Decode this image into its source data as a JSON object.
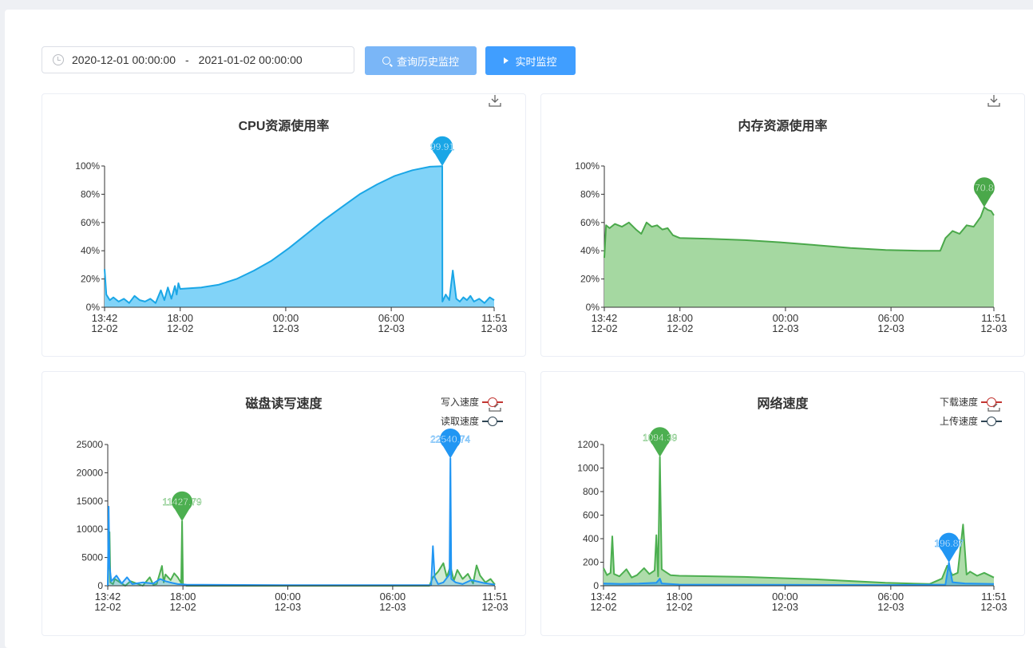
{
  "toolbar": {
    "range_start": "2020-12-01 00:00:00",
    "range_separator": "-",
    "range_end": "2021-01-02 00:00:00",
    "history_button": "查询历史监控",
    "live_button": "实时监控"
  },
  "icons": {
    "clock": "clock-icon",
    "search": "search-icon",
    "play": "play-icon",
    "download": "download-icon"
  },
  "colors": {
    "primary": "#409eff",
    "primary_light": "#7ab6f7",
    "cpu_line": "#1aa6e6",
    "cpu_fill": "#81d3f8",
    "mem_line": "#4aa84a",
    "mem_fill": "#a5d8a1",
    "write_series": "#4caf50",
    "read_series": "#2196f3",
    "legend_write": "#c23531",
    "legend_read": "#2f4554"
  },
  "chart_data": [
    {
      "id": "cpu",
      "type": "area",
      "title": "CPU资源使用率",
      "x_ticks": [
        [
          "13:42",
          "12-02"
        ],
        [
          "18:00",
          "12-02"
        ],
        [
          "00:00",
          "12-03"
        ],
        [
          "06:00",
          "12-03"
        ],
        [
          "11:51",
          "12-03"
        ]
      ],
      "x_tick_hours": [
        0,
        4.3,
        10.3,
        16.3,
        22.15
      ],
      "y_ticks": [
        "0%",
        "20%",
        "40%",
        "60%",
        "80%",
        "100%"
      ],
      "ylim": [
        0,
        100
      ],
      "markers": [
        {
          "label": "99.91",
          "x_hours": 19.2,
          "y": 99.91,
          "color": "#1aa6e6"
        }
      ],
      "series": [
        {
          "x_hours": [
            0,
            0.1,
            0.3,
            0.5,
            0.8,
            1.1,
            1.4,
            1.7,
            2.0,
            2.3,
            2.6,
            2.9,
            3.2,
            3.4,
            3.6,
            3.8,
            4.0,
            4.1,
            4.2,
            4.3,
            5.5,
            6.5,
            7.5,
            8.5,
            9.5,
            10.5,
            11.5,
            12.5,
            13.5,
            14.5,
            15.5,
            16.5,
            17.5,
            18.5,
            19.2,
            19.21,
            19.4,
            19.6,
            19.8,
            20.0,
            20.2,
            20.4,
            20.6,
            20.8,
            21.0,
            21.3,
            21.6,
            21.9,
            22.15
          ],
          "values": [
            27,
            9,
            5,
            7,
            4,
            6,
            3,
            8,
            5,
            4,
            6,
            3,
            12,
            5,
            14,
            6,
            15,
            9,
            17,
            13,
            14,
            16,
            20,
            26,
            33,
            42,
            52,
            62,
            71,
            80,
            87,
            93,
            97,
            99.5,
            99.91,
            4,
            9,
            5,
            26,
            6,
            4,
            7,
            5,
            8,
            4,
            6,
            3,
            7,
            5
          ]
        }
      ]
    },
    {
      "id": "memory",
      "type": "area",
      "title": "内存资源使用率",
      "x_ticks": [
        [
          "13:42",
          "12-02"
        ],
        [
          "18:00",
          "12-02"
        ],
        [
          "00:00",
          "12-03"
        ],
        [
          "06:00",
          "12-03"
        ],
        [
          "11:51",
          "12-03"
        ]
      ],
      "x_tick_hours": [
        0,
        4.3,
        10.3,
        16.3,
        22.15
      ],
      "y_ticks": [
        "0%",
        "20%",
        "40%",
        "60%",
        "80%",
        "100%"
      ],
      "ylim": [
        0,
        100
      ],
      "markers": [
        {
          "label": "70.8",
          "x_hours": 21.6,
          "y": 70.8,
          "color": "#4aa84a"
        }
      ],
      "series": [
        {
          "x_hours": [
            0,
            0.1,
            0.3,
            0.6,
            1.0,
            1.4,
            1.8,
            2.1,
            2.4,
            2.7,
            3.0,
            3.3,
            3.6,
            3.9,
            4.3,
            6,
            8,
            10,
            12,
            14,
            16,
            18,
            19.1,
            19.4,
            19.8,
            20.2,
            20.6,
            21.0,
            21.4,
            21.6,
            21.8,
            22.0,
            22.15
          ],
          "values": [
            35,
            58,
            56,
            59,
            57,
            60,
            55,
            52,
            60,
            57,
            58,
            55,
            56,
            51,
            49,
            48.5,
            47.5,
            46,
            44,
            42,
            40.5,
            40,
            40,
            49,
            54,
            52,
            58,
            57,
            64,
            70.8,
            69,
            68,
            65
          ]
        }
      ]
    },
    {
      "id": "disk",
      "type": "area",
      "title": "磁盘读写速度",
      "legend": [
        "写入速度",
        "读取速度"
      ],
      "x_ticks": [
        [
          "13:42",
          "12-02"
        ],
        [
          "18:00",
          "12-02"
        ],
        [
          "00:00",
          "12-03"
        ],
        [
          "06:00",
          "12-03"
        ],
        [
          "11:51",
          "12-03"
        ]
      ],
      "x_tick_hours": [
        0,
        4.3,
        10.3,
        16.3,
        22.15
      ],
      "y_ticks": [
        "0",
        "5000",
        "10000",
        "15000",
        "20000",
        "25000"
      ],
      "ylim": [
        0,
        25000
      ],
      "markers": [
        {
          "label": "11427.79",
          "x_hours": 4.25,
          "y": 11427.79,
          "color": "#4caf50"
        },
        {
          "label": "22540.74",
          "x_hours": 19.6,
          "y": 22540.74,
          "color": "#2196f3"
        }
      ],
      "series": [
        {
          "name": "写入速度",
          "x_hours": [
            0,
            0.1,
            0.15,
            0.3,
            0.4,
            1.0,
            1.3,
            2.0,
            2.4,
            2.6,
            2.8,
            3.1,
            3.2,
            3.3,
            3.6,
            3.8,
            4.0,
            4.2,
            4.25,
            4.3,
            4.5,
            10,
            16,
            18.4,
            18.6,
            18.9,
            19.2,
            19.4,
            19.6,
            19.8,
            20.0,
            20.3,
            20.6,
            20.9,
            21.1,
            21.3,
            21.6,
            21.9,
            22.15
          ],
          "values": [
            0,
            9500,
            600,
            300,
            1200,
            0,
            800,
            0,
            1500,
            200,
            300,
            3500,
            600,
            2000,
            1000,
            2200,
            1500,
            500,
            11427.79,
            300,
            0,
            0,
            0,
            0,
            1500,
            2500,
            4000,
            1500,
            3500,
            900,
            2800,
            1200,
            2100,
            400,
            3600,
            1800,
            600,
            1200,
            200
          ]
        },
        {
          "name": "读取速度",
          "x_hours": [
            0,
            0.05,
            0.1,
            0.2,
            0.5,
            0.8,
            1.1,
            1.4,
            2.0,
            2.6,
            3.0,
            3.3,
            3.7,
            4.0,
            4.5,
            10,
            16,
            18.5,
            18.6,
            18.7,
            18.9,
            19.2,
            19.55,
            19.6,
            19.65,
            19.9,
            20.3,
            20.8,
            21.5,
            22.15
          ],
          "values": [
            0,
            14000,
            3500,
            800,
            1800,
            400,
            1500,
            300,
            600,
            400,
            1200,
            800,
            500,
            300,
            200,
            100,
            100,
            100,
            7000,
            1500,
            300,
            600,
            2000,
            22540.74,
            1200,
            600,
            300,
            1000,
            500,
            200
          ]
        }
      ]
    },
    {
      "id": "network",
      "type": "area",
      "title": "网络速度",
      "legend": [
        "下载速度",
        "上传速度"
      ],
      "x_ticks": [
        [
          "13:42",
          "12-02"
        ],
        [
          "18:00",
          "12-02"
        ],
        [
          "00:00",
          "12-03"
        ],
        [
          "06:00",
          "12-03"
        ],
        [
          "11:51",
          "12-03"
        ]
      ],
      "x_tick_hours": [
        0,
        4.3,
        10.3,
        16.3,
        22.15
      ],
      "y_ticks": [
        "0",
        "200",
        "400",
        "600",
        "800",
        "1000",
        "1200"
      ],
      "ylim": [
        0,
        1200
      ],
      "markers": [
        {
          "label": "1094.39",
          "x_hours": 3.2,
          "y": 1094.39,
          "color": "#4caf50"
        },
        {
          "label": "196.87",
          "x_hours": 19.6,
          "y": 196.87,
          "color": "#2196f3"
        }
      ],
      "series": [
        {
          "name": "下载速度",
          "x_hours": [
            0,
            0.2,
            0.4,
            0.5,
            0.6,
            0.9,
            1.3,
            1.6,
            1.9,
            2.3,
            2.6,
            2.9,
            3.0,
            3.1,
            3.2,
            3.3,
            3.5,
            3.8,
            4.3,
            8,
            12,
            16,
            18.5,
            19.2,
            19.5,
            19.8,
            20.1,
            20.4,
            20.6,
            20.8,
            21.2,
            21.6,
            22.15
          ],
          "values": [
            150,
            90,
            110,
            420,
            100,
            80,
            140,
            70,
            90,
            150,
            100,
            130,
            430,
            80,
            1094.39,
            140,
            120,
            90,
            85,
            75,
            55,
            25,
            15,
            60,
            170,
            90,
            110,
            520,
            95,
            120,
            85,
            110,
            70
          ]
        },
        {
          "name": "上传速度",
          "x_hours": [
            0,
            1,
            2,
            3,
            3.2,
            3.3,
            4.3,
            10,
            16,
            19.4,
            19.6,
            19.8,
            20.5,
            22.15
          ],
          "values": [
            20,
            15,
            18,
            25,
            60,
            20,
            10,
            8,
            6,
            10,
            196.87,
            30,
            20,
            15
          ]
        }
      ]
    }
  ]
}
